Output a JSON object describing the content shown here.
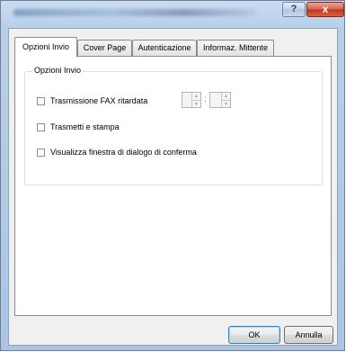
{
  "window": {
    "help_glyph": "?",
    "close_glyph": "x"
  },
  "tabs": [
    {
      "label": "Opzioni Invio",
      "active": true
    },
    {
      "label": "Cover Page",
      "active": false
    },
    {
      "label": "Autenticazione",
      "active": false
    },
    {
      "label": "Informaz. Mittente",
      "active": false
    }
  ],
  "group": {
    "title": "Opzioni Invio"
  },
  "options": [
    {
      "label": "Trasmissione FAX ritardata",
      "checked": false
    },
    {
      "label": "Trasmetti e stampa",
      "checked": false
    },
    {
      "label": "Visualizza finestra di dialogo di conferma",
      "checked": false
    }
  ],
  "time_separator": ":",
  "buttons": {
    "ok": "OK",
    "cancel": "Annulla"
  },
  "colors": {
    "title_gradient": "#b7cfe9",
    "close_button": "#c0391f",
    "dialog_bg": "#f0f0f0",
    "panel_bg": "#ffffff"
  }
}
